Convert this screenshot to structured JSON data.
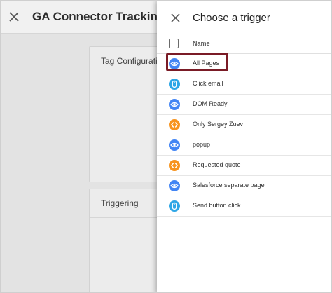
{
  "background": {
    "title": "GA Connector Tracking Code",
    "cards": {
      "tag": "Tag Configuration",
      "trigger": "Triggering"
    }
  },
  "panel": {
    "title": "Choose a trigger",
    "column_header": "Name",
    "triggers": [
      {
        "label": "All Pages",
        "icon": "eye-icon",
        "color": "#4285f4"
      },
      {
        "label": "Click email",
        "icon": "mouse-icon",
        "color": "#2ea6e6"
      },
      {
        "label": "DOM Ready",
        "icon": "eye-icon",
        "color": "#4285f4"
      },
      {
        "label": "Only Sergey Zuev",
        "icon": "code-icon",
        "color": "#f7931e"
      },
      {
        "label": "popup",
        "icon": "eye-icon",
        "color": "#4285f4"
      },
      {
        "label": "Requested quote",
        "icon": "code-icon",
        "color": "#f7931e"
      },
      {
        "label": "Salesforce separate page",
        "icon": "eye-icon",
        "color": "#4285f4"
      },
      {
        "label": "Send button click",
        "icon": "mouse-icon",
        "color": "#2ea6e6"
      }
    ]
  },
  "colors": {
    "highlight_border": "#7a1b26",
    "eye_trigger": "#4285f4",
    "click_trigger": "#2ea6e6",
    "custom_trigger": "#f7931e"
  }
}
